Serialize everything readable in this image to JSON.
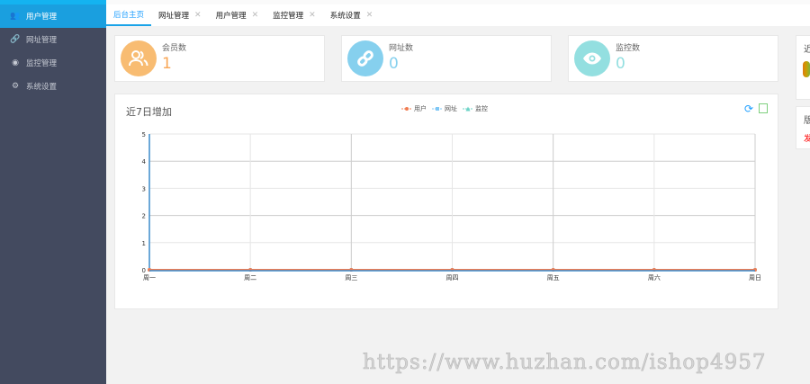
{
  "sidebar": {
    "items": [
      {
        "label": "用户管理",
        "icon": "users-icon"
      },
      {
        "label": "网址管理",
        "icon": "link-icon"
      },
      {
        "label": "监控管理",
        "icon": "eye-icon"
      },
      {
        "label": "系统设置",
        "icon": "gear-icon"
      }
    ]
  },
  "tabs": [
    {
      "label": "后台主页"
    },
    {
      "label": "网址管理"
    },
    {
      "label": "用户管理"
    },
    {
      "label": "监控管理"
    },
    {
      "label": "系统设置"
    }
  ],
  "cards": [
    {
      "label": "会员数",
      "value": "1",
      "color": "#f8bc72"
    },
    {
      "label": "网址数",
      "value": "0",
      "color": "#86d0ee"
    },
    {
      "label": "监控数",
      "value": "0",
      "color": "#93dfe0"
    }
  ],
  "right": {
    "panel1_title": "近",
    "panel2_title": "版",
    "panel2_text": "发"
  },
  "chart_data": {
    "type": "line",
    "title": "近7日增加",
    "categories": [
      "周一",
      "周二",
      "周三",
      "周四",
      "周五",
      "周六",
      "周日"
    ],
    "series": [
      {
        "name": "用户",
        "color": "#f07c52",
        "values": [
          0,
          0,
          0,
          0,
          0,
          0,
          0
        ]
      },
      {
        "name": "网址",
        "color": "#7fc7f5",
        "values": [
          0,
          0,
          0,
          0,
          0,
          0,
          0
        ]
      },
      {
        "name": "监控",
        "color": "#6dd3c7",
        "values": [
          0,
          0,
          0,
          0,
          0,
          0,
          0
        ]
      }
    ],
    "ylim": [
      0,
      5
    ],
    "yticks": [
      "0",
      "1",
      "2",
      "3",
      "4",
      "5"
    ],
    "legend": "top-center",
    "grid": true
  },
  "watermark": "https://www.huzhan.com/ishop4957"
}
